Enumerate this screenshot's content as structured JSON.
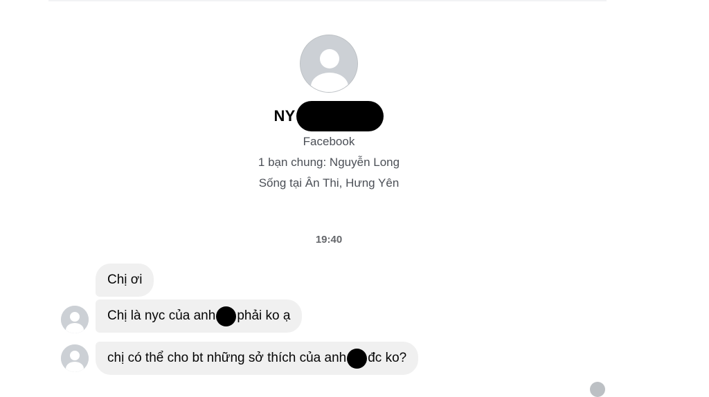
{
  "profile": {
    "name_visible": "NY",
    "source": "Facebook",
    "mutual_friends": "1 bạn chung: Nguyễn Long",
    "location": "Sống tại Ân Thi, Hưng Yên"
  },
  "conversation": {
    "timestamp": "19:40",
    "messages": [
      {
        "parts": [
          "Chị ơi"
        ]
      },
      {
        "parts": [
          "Chị là nyc của anh",
          " phải ko ạ"
        ]
      },
      {
        "parts": [
          "chị có thể cho bt những sở thích của anh",
          " đc ko?"
        ]
      }
    ]
  },
  "colors": {
    "bubble": "#f0f0f0",
    "avatar_placeholder": "#ccd0d5",
    "secondary_text": "#65676b",
    "redaction": "#000000"
  },
  "icons": {
    "profile_avatar": "default-user-avatar-icon",
    "message_avatar": "default-user-avatar-icon"
  }
}
